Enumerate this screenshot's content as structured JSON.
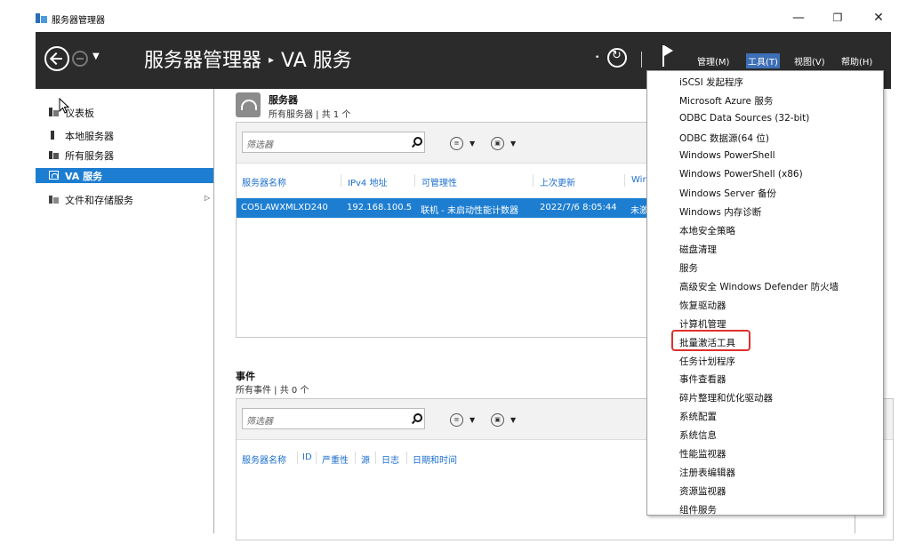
{
  "window": {
    "title": "服务器管理器",
    "minimize_glyph": "—",
    "restore_glyph": "❐",
    "close_glyph": "✕"
  },
  "header": {
    "breadcrumb_root": "服务器管理器",
    "breadcrumb_separator": "▸",
    "breadcrumb_current": "VA 服务",
    "menu": {
      "manage": "管理(M)",
      "tools": "工具(T)",
      "view": "视图(V)",
      "help": "帮助(H)"
    }
  },
  "sidebar": {
    "items": [
      {
        "label": "仪表板",
        "icon": "dashboard-icon"
      },
      {
        "label": "本地服务器",
        "icon": "local-server-icon"
      },
      {
        "label": "所有服务器",
        "icon": "all-servers-icon"
      },
      {
        "label": "VA 服务",
        "icon": "va-service-icon",
        "selected": true
      },
      {
        "label": "文件和存储服务",
        "icon": "file-storage-icon",
        "expandable": true
      }
    ]
  },
  "servers_panel": {
    "title": "服务器",
    "subtitle": "所有服务器 | 共 1 个",
    "filter_placeholder": "筛选器",
    "columns": [
      "服务器名称",
      "IPv4 地址",
      "可管理性",
      "上次更新",
      "Wir"
    ],
    "rows": [
      {
        "name": "CO5LAWXMLXD240",
        "ipv4": "192.168.100.5",
        "manageability": "联机 - 未启动性能计数器",
        "last_update": "2022/7/6 8:05:44",
        "extra": "未激"
      }
    ]
  },
  "events_panel": {
    "title": "事件",
    "subtitle": "所有事件 | 共 0 个",
    "filter_placeholder": "筛选器",
    "columns": [
      "服务器名称",
      "ID",
      "严重性",
      "源",
      "日志",
      "日期和时间"
    ]
  },
  "tools_menu": {
    "items": [
      "iSCSI 发起程序",
      "Microsoft Azure 服务",
      "ODBC Data Sources (32-bit)",
      "ODBC 数据源(64 位)",
      "Windows PowerShell",
      "Windows PowerShell (x86)",
      "Windows Server 备份",
      "Windows 内存诊断",
      "本地安全策略",
      "磁盘清理",
      "服务",
      "高级安全 Windows Defender 防火墙",
      "恢复驱动器",
      "计算机管理",
      "批量激活工具",
      "任务计划程序",
      "事件查看器",
      "碎片整理和优化驱动器",
      "系统配置",
      "系统信息",
      "性能监视器",
      "注册表编辑器",
      "资源监视器",
      "组件服务"
    ],
    "highlighted": "批量激活工具"
  },
  "colors": {
    "header_bg": "#2b2b2b",
    "selection_blue": "#1d7ed1",
    "highlight_red": "#e0302c",
    "link_blue": "#1d6fcf"
  }
}
